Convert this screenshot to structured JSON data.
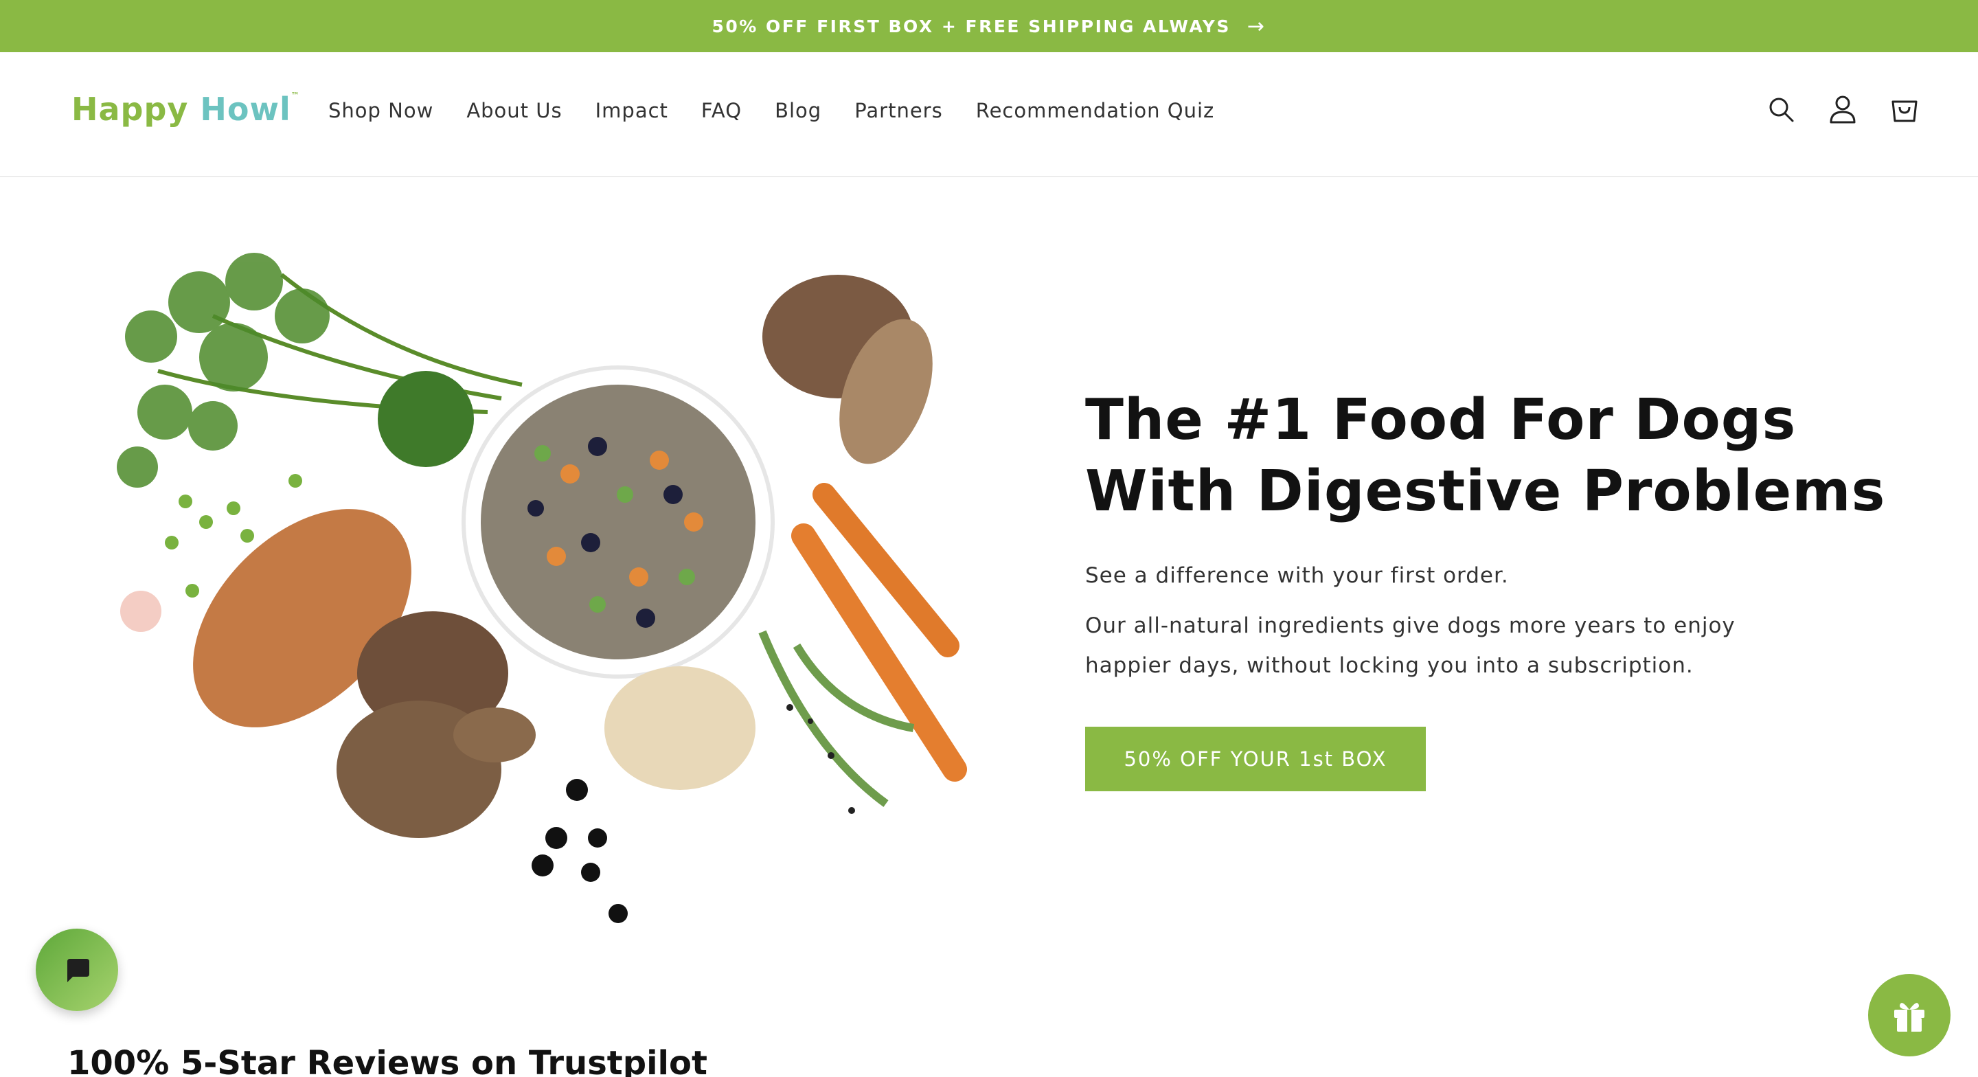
{
  "announcement": {
    "text": "50% OFF FIRST BOX + FREE SHIPPING ALWAYS",
    "arrow_icon": "arrow-right-icon"
  },
  "logo": {
    "word1": "Happy",
    "word2": "Howl",
    "tm": "™"
  },
  "nav": [
    {
      "label": "Shop Now"
    },
    {
      "label": "About Us"
    },
    {
      "label": "Impact"
    },
    {
      "label": "FAQ"
    },
    {
      "label": "Blog"
    },
    {
      "label": "Partners"
    },
    {
      "label": "Recommendation Quiz"
    }
  ],
  "header_icons": [
    "search-icon",
    "account-icon",
    "cart-icon"
  ],
  "hero": {
    "title": "The #1 Food For Dogs With Digestive Problems",
    "subtitle": "See a difference with your first order.",
    "description": "Our all-natural ingredients give dogs more years to enjoy happier days, without locking you into a subscription.",
    "cta": "50% OFF YOUR 1st BOX"
  },
  "reviews_heading": "100% 5-Star Reviews on Trustpilot",
  "colors": {
    "brand_green": "#8ab944",
    "brand_teal": "#6cc3c0"
  }
}
